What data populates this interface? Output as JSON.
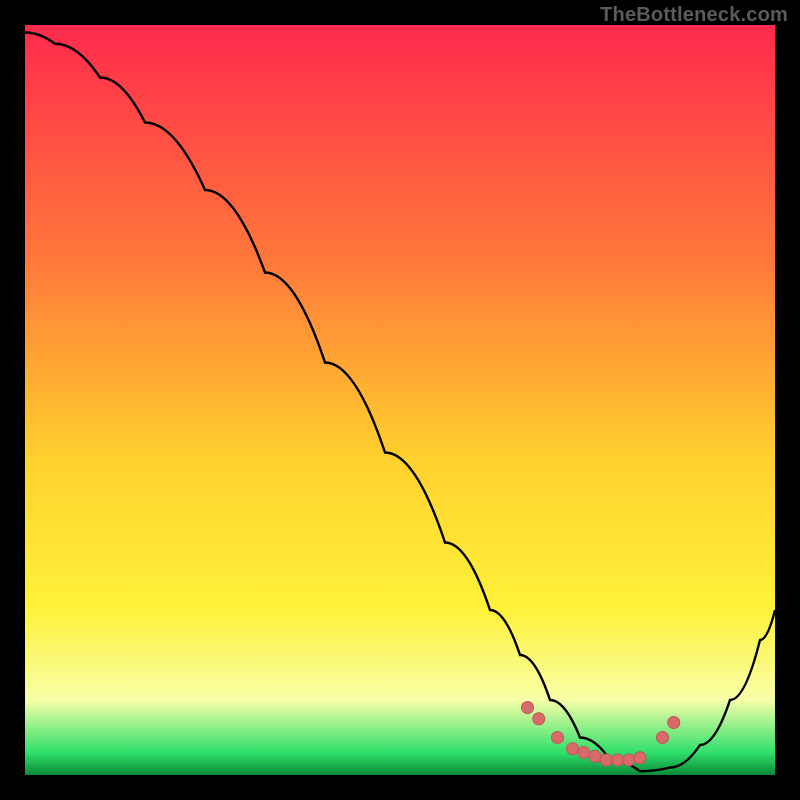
{
  "watermark": "TheBottleneck.com",
  "colors": {
    "bg": "#000000",
    "curve": "#000000",
    "marker_fill": "#d86a6a",
    "marker_stroke": "#c25555",
    "grad_top": "#ff2a4d",
    "grad_mid_upper": "#ff7a3a",
    "grad_mid": "#ffd12e",
    "grad_mid_lower": "#fff23a",
    "grad_low": "#f7ffa8",
    "grad_green": "#2fe06a",
    "grad_bottom": "#0a8a3a"
  },
  "chart_data": {
    "type": "line",
    "title": "",
    "xlabel": "",
    "ylabel": "",
    "xlim": [
      0,
      100
    ],
    "ylim": [
      0,
      100
    ],
    "curve": {
      "name": "bottleneck-curve",
      "x": [
        0,
        4,
        10,
        16,
        24,
        32,
        40,
        48,
        56,
        62,
        66,
        70,
        74,
        78,
        82,
        86,
        90,
        94,
        98,
        100
      ],
      "y": [
        99,
        97.5,
        93,
        87,
        78,
        67,
        55,
        43,
        31,
        22,
        16,
        10,
        5,
        2,
        0.5,
        1,
        4,
        10,
        18,
        22
      ]
    },
    "markers": {
      "name": "optimal-range",
      "x": [
        67,
        68.5,
        71,
        73,
        74.5,
        76,
        77.5,
        79,
        80.5,
        82,
        85,
        86.5
      ],
      "y": [
        9,
        7.5,
        5,
        3.5,
        3,
        2.5,
        2,
        2,
        2,
        2.3,
        5,
        7
      ]
    }
  }
}
